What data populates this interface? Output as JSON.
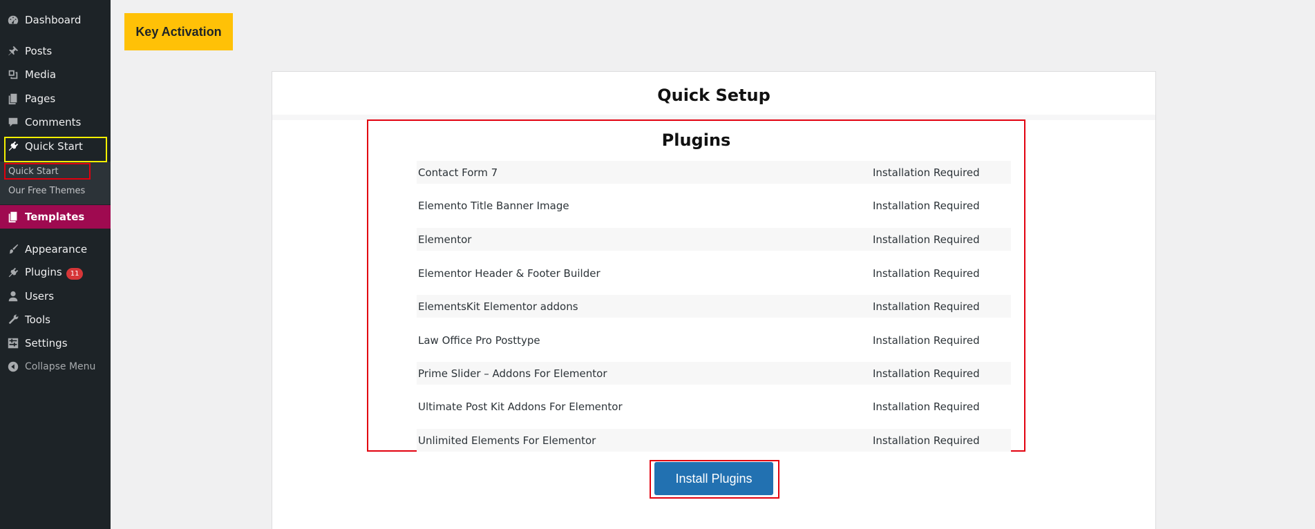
{
  "sidebar": {
    "items": [
      {
        "key": "dashboard",
        "label": "Dashboard",
        "icon": "dashboard-icon"
      },
      {
        "key": "posts",
        "label": "Posts",
        "icon": "pin-icon"
      },
      {
        "key": "media",
        "label": "Media",
        "icon": "media-icon"
      },
      {
        "key": "pages",
        "label": "Pages",
        "icon": "pages-icon"
      },
      {
        "key": "comments",
        "label": "Comments",
        "icon": "comment-icon"
      },
      {
        "key": "quick-start",
        "label": "Quick Start",
        "icon": "plugin-icon"
      }
    ],
    "submenu": [
      {
        "label": "Quick Start"
      },
      {
        "label": "Our Free Themes"
      }
    ],
    "templates": {
      "label": "Templates",
      "icon": "pages-icon"
    },
    "items2": [
      {
        "key": "appearance",
        "label": "Appearance",
        "icon": "brush-icon"
      },
      {
        "key": "plugins",
        "label": "Plugins",
        "icon": "plugin-icon",
        "badge": "11"
      },
      {
        "key": "users",
        "label": "Users",
        "icon": "user-icon"
      },
      {
        "key": "tools",
        "label": "Tools",
        "icon": "wrench-icon"
      },
      {
        "key": "settings",
        "label": "Settings",
        "icon": "settings-icon"
      }
    ],
    "collapse": {
      "label": "Collapse Menu",
      "icon": "collapse-icon"
    }
  },
  "main": {
    "key_activation_label": "Key Activation",
    "quick_setup_title": "Quick Setup",
    "plugins_title": "Plugins",
    "plugins": [
      {
        "name": "Contact Form 7",
        "status": "Installation Required"
      },
      {
        "name": "Elemento Title Banner Image",
        "status": "Installation Required"
      },
      {
        "name": "Elementor",
        "status": "Installation Required"
      },
      {
        "name": "Elementor Header & Footer Builder",
        "status": "Installation Required"
      },
      {
        "name": "ElementsKit Elementor addons",
        "status": "Installation Required"
      },
      {
        "name": "Law Office Pro Posttype",
        "status": "Installation Required"
      },
      {
        "name": "Prime Slider – Addons For Elementor",
        "status": "Installation Required"
      },
      {
        "name": "Ultimate Post Kit Addons For Elementor",
        "status": "Installation Required"
      },
      {
        "name": "Unlimited Elements For Elementor",
        "status": "Installation Required"
      }
    ],
    "install_button_label": "Install Plugins"
  },
  "colors": {
    "sidebar_bg": "#1d2327",
    "templates_bg": "#9f0a50",
    "key_button_bg": "#ffc107",
    "install_button_bg": "#2271b1",
    "highlight_red": "#e2000e",
    "highlight_yellow": "#f4f000"
  }
}
